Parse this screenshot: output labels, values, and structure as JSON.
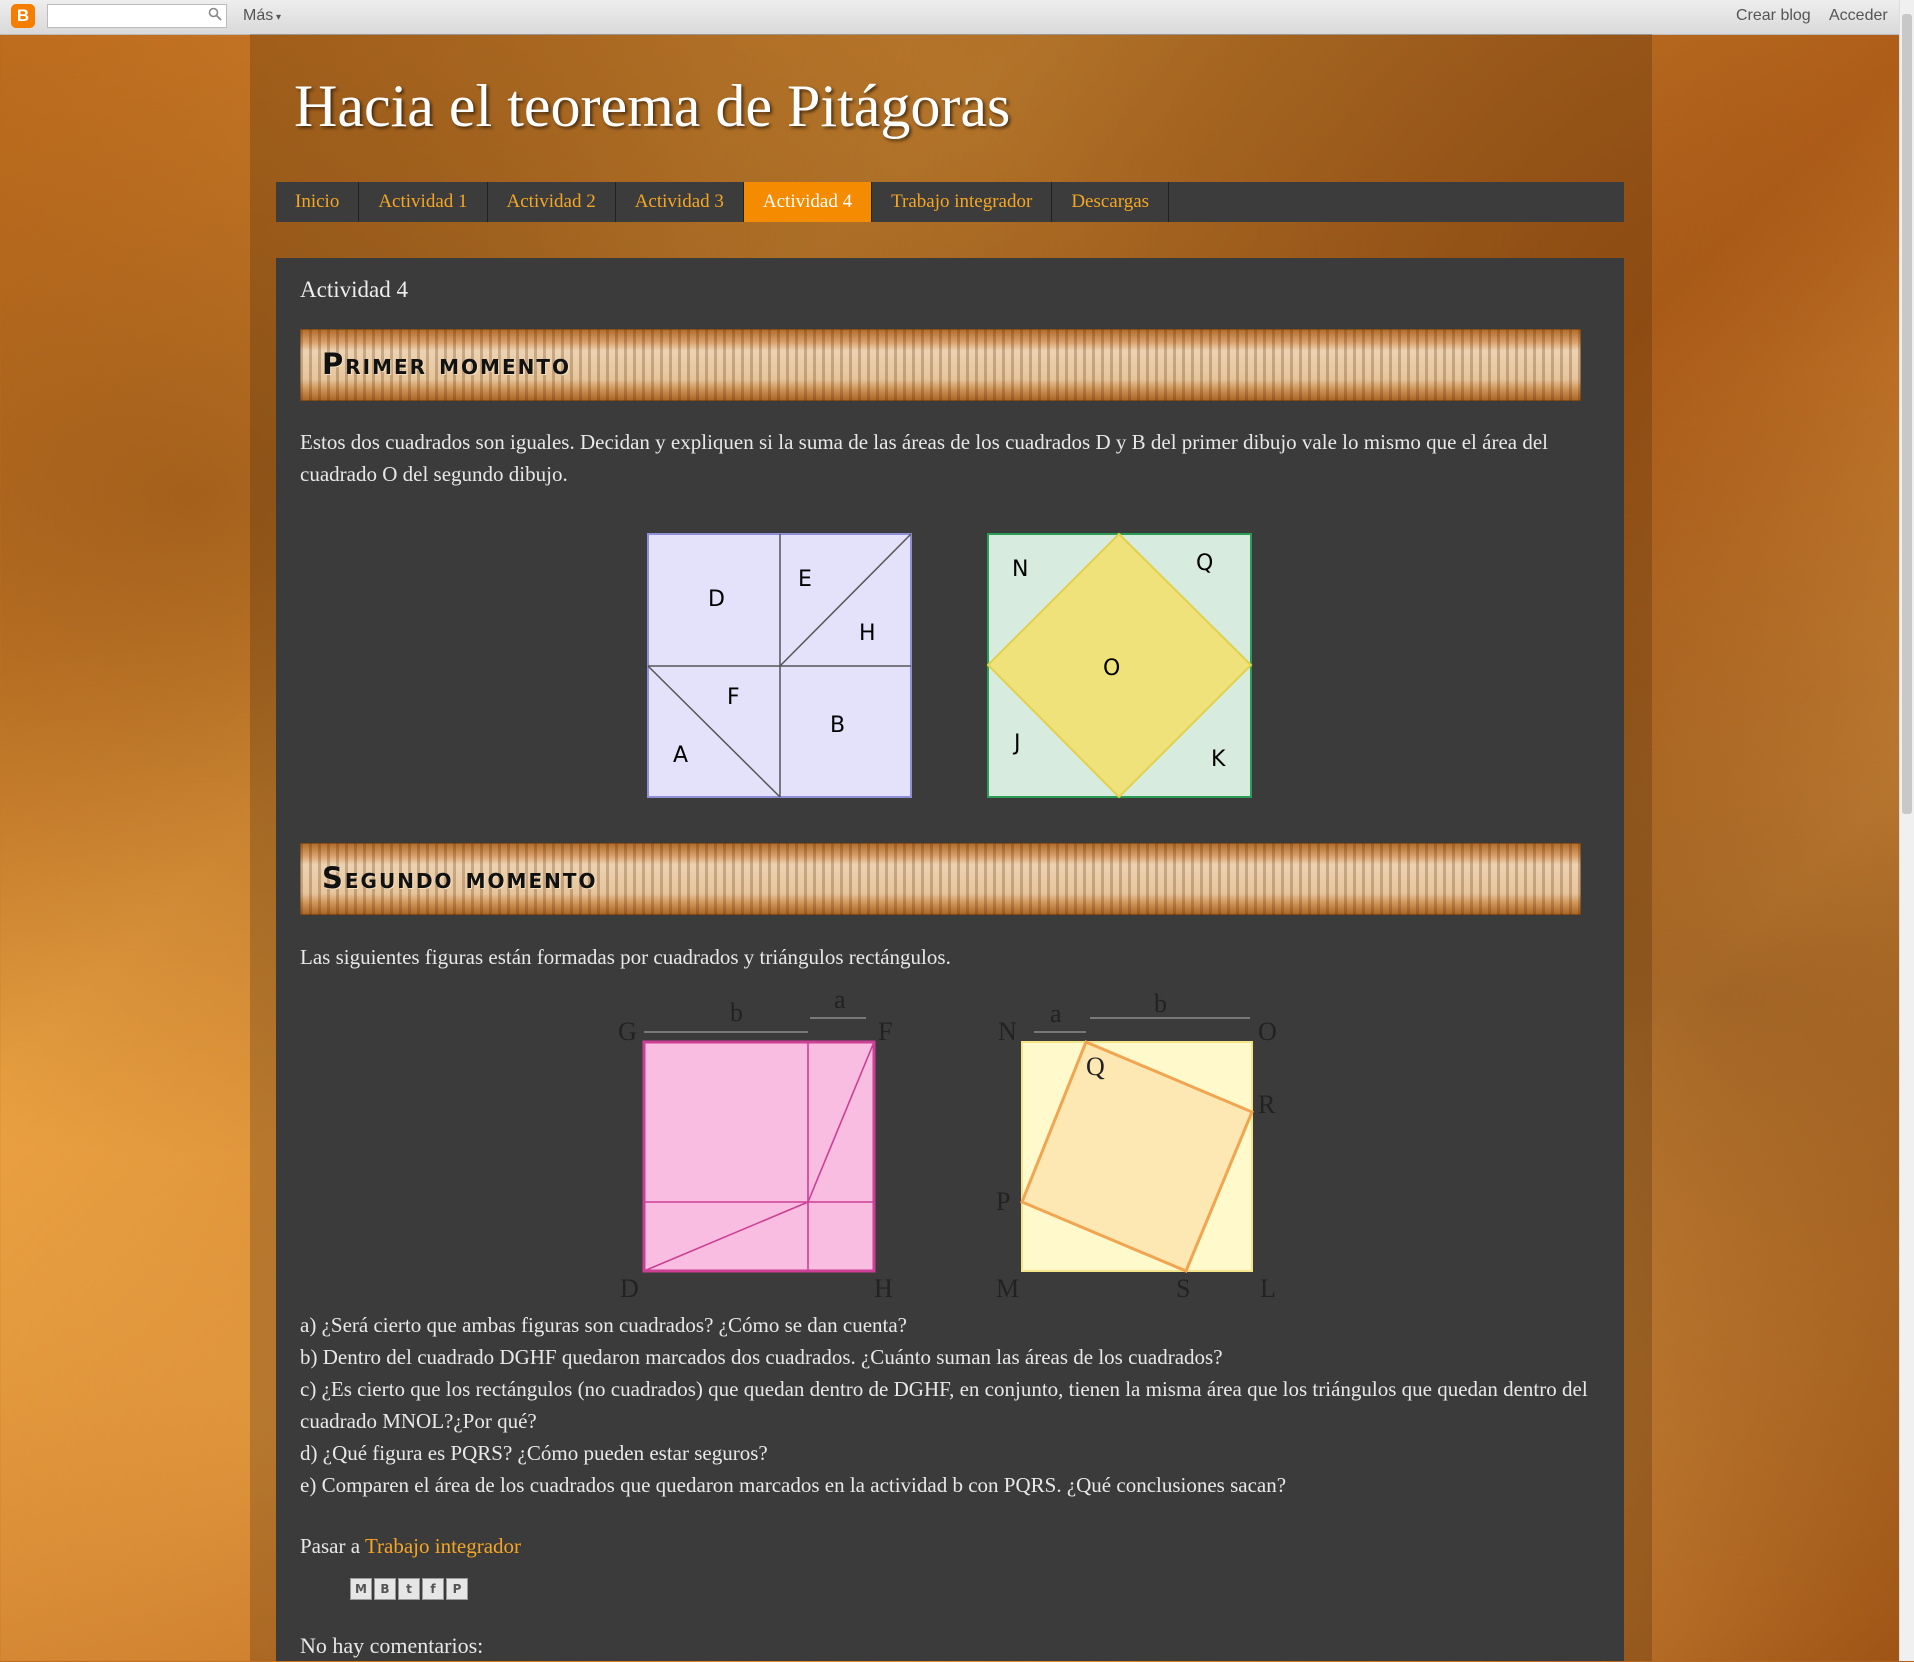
{
  "navbar": {
    "mas": "Más",
    "crear_blog": "Crear blog",
    "acceder": "Acceder",
    "logo_glyph": "B"
  },
  "blog_title": "Hacia el teorema de Pitágoras",
  "tabs": [
    "Inicio",
    "Actividad 1",
    "Actividad 2",
    "Actividad 3",
    "Actividad 4",
    "Trabajo integrador",
    "Descargas"
  ],
  "active_tab": "Actividad 4",
  "post": {
    "title": "Actividad 4",
    "banner1": "Primer momento",
    "intro": "Estos dos cuadrados son iguales. Decidan y expliquen si la suma de las áreas de los cuadrados D y B del primer dibujo vale lo mismo que el área del cuadrado O del segundo dibujo.",
    "figure1_left_labels": {
      "D": "D",
      "E": "E",
      "H": "H",
      "F": "F",
      "A": "A",
      "B": "B"
    },
    "figure1_right_labels": {
      "N": "N",
      "Q": "Q",
      "O": "O",
      "J": "J",
      "K": "K"
    },
    "banner2": "Segundo momento",
    "intro2": "Las siguientes figuras están formadas por cuadrados y triángulos rectángulos.",
    "figure2_left_labels": {
      "b": "b",
      "a": "a",
      "G": "G",
      "F": "F",
      "D": "D",
      "H": "H"
    },
    "figure2_right_labels": {
      "a": "a",
      "b": "b",
      "N": "N",
      "O": "O",
      "Q": "Q",
      "R": "R",
      "P": "P",
      "M": "M",
      "S": "S",
      "L": "L"
    },
    "questions": [
      "a) ¿Será cierto que ambas figuras son cuadrados? ¿Cómo se dan cuenta?",
      "b) Dentro del cuadrado DGHF quedaron marcados dos cuadrados. ¿Cuánto suman las áreas de los cuadrados?",
      "c) ¿Es cierto que los rectángulos (no cuadrados) que quedan dentro de DGHF, en conjunto, tienen la misma área que los triángulos que quedan dentro del cuadrado MNOL?¿Por qué?",
      "d) ¿Qué figura es PQRS? ¿Cómo pueden estar seguros?",
      "e) Comparen el área de los cuadrados que quedaron marcados en la actividad b con PQRS. ¿Qué conclusiones sacan?"
    ],
    "pasar_prefix": "Pasar a ",
    "pasar_link": "Trabajo integrador",
    "share_buttons": [
      "M",
      "B",
      "t",
      "f",
      "P"
    ],
    "comments": "No hay comentarios:"
  },
  "colors": {
    "accent": "#f58b00",
    "tab_text": "#f5a623",
    "panel": "#3b3b3b"
  }
}
